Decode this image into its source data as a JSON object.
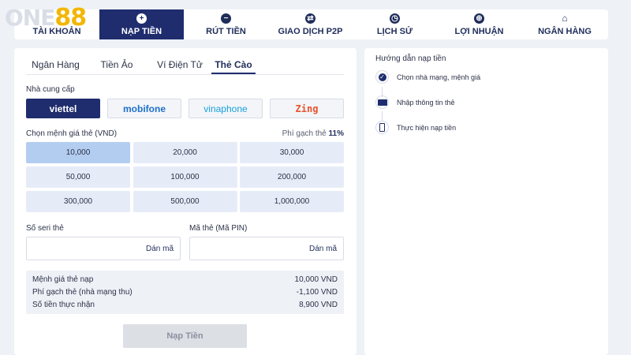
{
  "logo": {
    "part1": "ONE",
    "part2": "88"
  },
  "nav": [
    {
      "label": "TÀI KHOẢN",
      "icon": "user-icon"
    },
    {
      "label": "NẠP TIỀN",
      "icon": "plus-icon"
    },
    {
      "label": "RÚT TIỀN",
      "icon": "minus-icon"
    },
    {
      "label": "GIAO DỊCH P2P",
      "icon": "exchange-icon"
    },
    {
      "label": "LỊCH SỬ",
      "icon": "clock-icon"
    },
    {
      "label": "LỢI NHUẬN",
      "icon": "globe-icon"
    },
    {
      "label": "NGÂN HÀNG",
      "icon": "bank-icon"
    }
  ],
  "tabs": [
    {
      "label": "Ngân Hàng"
    },
    {
      "label": "Tiền Ảo"
    },
    {
      "label": "Ví Điện Tử"
    },
    {
      "label": "Thẻ Cào"
    }
  ],
  "provider_label": "Nhà cung cấp",
  "providers": [
    {
      "name": "viettel",
      "color": "#ffffff"
    },
    {
      "name": "mobifone",
      "color": "#1f6fc9"
    },
    {
      "name": "vinaphone",
      "color": "#1aa0dc"
    },
    {
      "name": "Zing",
      "color": "#e8532a"
    }
  ],
  "denom_label": "Chọn mệnh giá thẻ (VND)",
  "fee_label": "Phí gạch thẻ",
  "fee_value": "11%",
  "denominations": [
    "10,000",
    "20,000",
    "30,000",
    "50,000",
    "100,000",
    "200,000",
    "300,000",
    "500,000",
    "1,000,000"
  ],
  "serial": {
    "label": "Số seri thẻ",
    "paste": "Dán mã",
    "placeholder": ""
  },
  "pin": {
    "label": "Mã thẻ (Mã PIN)",
    "paste": "Dán mã",
    "placeholder": ""
  },
  "summary": [
    {
      "label": "Mệnh giá thẻ nạp",
      "value": "10,000 VND"
    },
    {
      "label": "Phí gạch thẻ (nhà mạng thu)",
      "value": "-1,100 VND"
    },
    {
      "label": "Số tiền thực nhận",
      "value": "8,900 VND"
    }
  ],
  "submit_label": "Nạp Tiền",
  "guide": {
    "title": "Hướng dẫn nạp tiền",
    "steps": [
      {
        "label": "Chọn nhà mạng, mệnh giá",
        "icon": "check-circle-icon"
      },
      {
        "label": "Nhập thông tin thẻ",
        "icon": "card-icon"
      },
      {
        "label": "Thực hiện nạp tiền",
        "icon": "phone-icon"
      }
    ]
  },
  "colors": {
    "primary": "#1f2d6e",
    "selected_denom": "#b3cdf0",
    "denom": "#e6ecf7",
    "logo_accent": "#f2b705"
  }
}
